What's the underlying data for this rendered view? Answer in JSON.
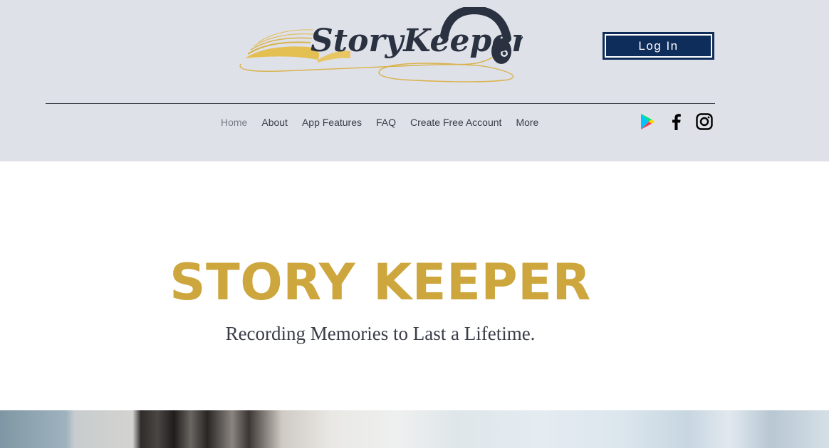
{
  "header": {
    "logo_text": "StoryKeeper",
    "login_label": "Log In"
  },
  "nav": {
    "items": [
      {
        "label": "Home",
        "active": true
      },
      {
        "label": "About",
        "active": false
      },
      {
        "label": "App Features",
        "active": false
      },
      {
        "label": "FAQ",
        "active": false
      },
      {
        "label": "Create Free Account",
        "active": false
      },
      {
        "label": "More",
        "active": false
      }
    ]
  },
  "social": {
    "icons": [
      "google-play-icon",
      "facebook-icon",
      "instagram-icon"
    ]
  },
  "hero": {
    "title": "STORY KEEPER",
    "subtitle": "Recording Memories to Last a Lifetime."
  },
  "colors": {
    "header_bg": "#dfe1e9",
    "accent_gold": "#cda63e",
    "button_navy": "#0f2d5a",
    "text_dark": "#3a3d47"
  }
}
